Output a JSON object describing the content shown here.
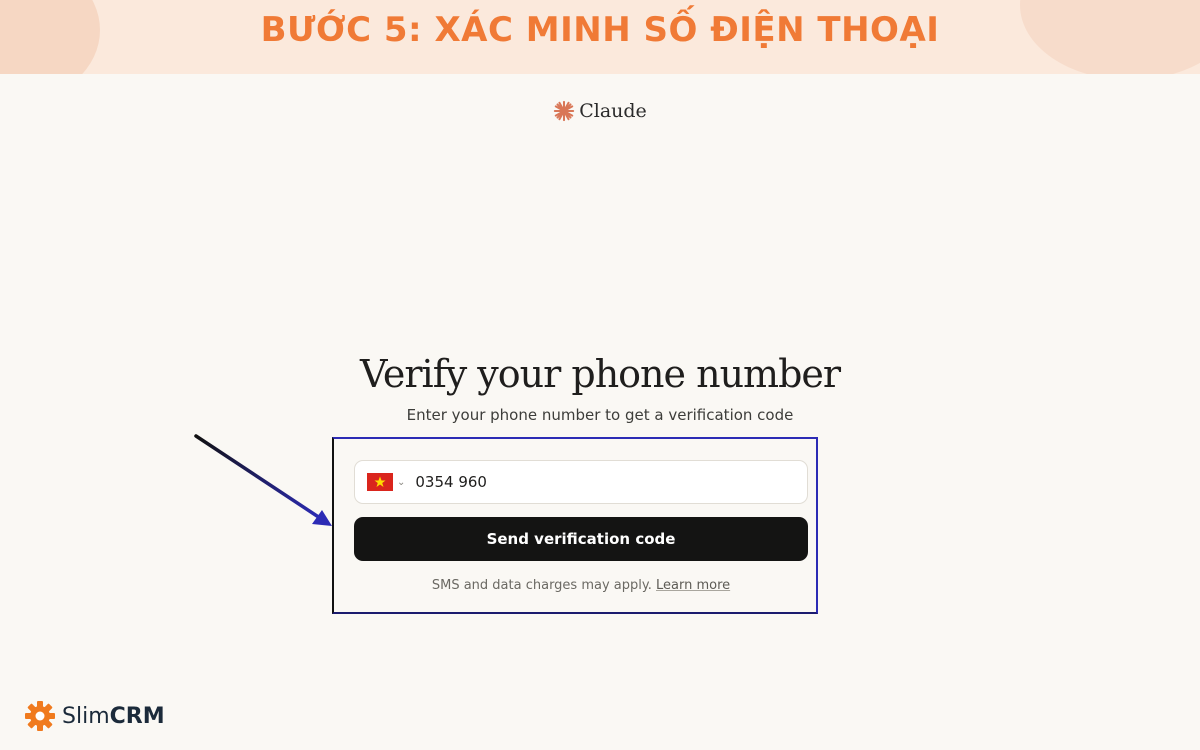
{
  "banner": {
    "title": "BƯỚC 5: XÁC MINH SỐ ĐIỆN THOẠI"
  },
  "brand": {
    "name": "Claude",
    "icon": "claude-sunburst-icon",
    "accent_color": "#d97757"
  },
  "form": {
    "heading": "Verify your phone number",
    "subheading": "Enter your phone number to get a verification code",
    "country_flag": "vietnam-flag-icon",
    "phone_value": "0354 960",
    "send_button_label": "Send verification code",
    "disclaimer": "SMS and data charges may apply.",
    "learn_more_label": "Learn more"
  },
  "footer_logo": {
    "brand_light": "Slim",
    "brand_bold": "CRM",
    "icon": "gear-icon",
    "icon_color": "#f07a1e"
  },
  "colors": {
    "banner_text": "#f07a36",
    "button_bg": "#141413",
    "highlight_border": "#2c2bb5"
  }
}
